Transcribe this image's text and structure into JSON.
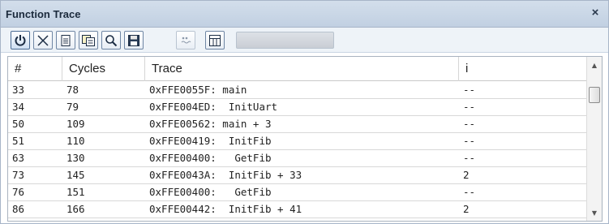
{
  "window": {
    "title": "Function Trace",
    "close_glyph": "×"
  },
  "toolbar": {
    "buttons": [
      {
        "name": "power-button",
        "icon": "power-icon"
      },
      {
        "name": "clear-button",
        "icon": "clear-icon"
      },
      {
        "name": "save-text-button",
        "icon": "document-icon"
      },
      {
        "name": "export-button",
        "icon": "export-icon"
      },
      {
        "name": "find-button",
        "icon": "search-icon"
      },
      {
        "name": "save-button",
        "icon": "floppy-disk-icon"
      },
      {
        "name": "settings-button",
        "icon": "dots-icon"
      },
      {
        "name": "layout-button",
        "icon": "grid-icon"
      }
    ]
  },
  "table": {
    "columns": [
      "#",
      "Cycles",
      "Trace",
      "i"
    ],
    "rows": [
      [
        "33",
        "78",
        "0xFFE0055F: main",
        "--"
      ],
      [
        "34",
        "79",
        "0xFFE004ED:  InitUart",
        "--"
      ],
      [
        "50",
        "109",
        "0xFFE00562: main + 3",
        "--"
      ],
      [
        "51",
        "110",
        "0xFFE00419:  InitFib",
        "--"
      ],
      [
        "63",
        "130",
        "0xFFE00400:   GetFib",
        "--"
      ],
      [
        "73",
        "145",
        "0xFFE0043A:  InitFib + 33",
        "2"
      ],
      [
        "76",
        "151",
        "0xFFE00400:   GetFib",
        "--"
      ],
      [
        "86",
        "166",
        "0xFFE00442:  InitFib + 41",
        "2"
      ]
    ]
  },
  "scrollbar": {
    "up_glyph": "▲",
    "down_glyph": "▼"
  },
  "colors": {
    "titlebar": "#c8d6e7",
    "accent": "#4b6c94",
    "grid_line": "#d8d8d8"
  }
}
